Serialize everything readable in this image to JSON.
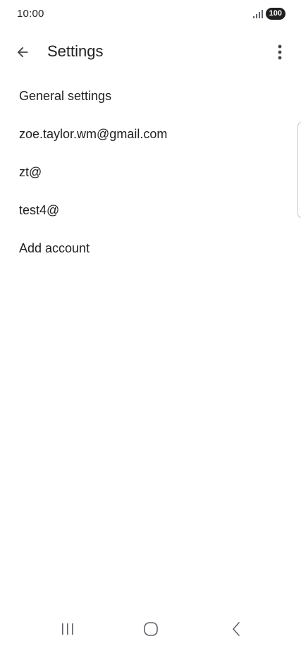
{
  "status_bar": {
    "time": "10:00",
    "battery": "100"
  },
  "app_bar": {
    "title": "Settings"
  },
  "settings": {
    "items": [
      {
        "label": "General settings"
      },
      {
        "label": "zoe.taylor.wm@gmail.com"
      },
      {
        "label": "zt@"
      },
      {
        "label": "test4@"
      },
      {
        "label": "Add account"
      }
    ]
  },
  "icons": {
    "back": "arrow-back-icon",
    "more": "more-vert-icon",
    "signal": "signal-icon",
    "nav_recents": "recents-icon",
    "nav_home": "home-icon",
    "nav_back": "chevron-left-icon"
  },
  "colors": {
    "text_primary": "#1f1f1f",
    "background": "#ffffff",
    "icon": "#444746"
  }
}
